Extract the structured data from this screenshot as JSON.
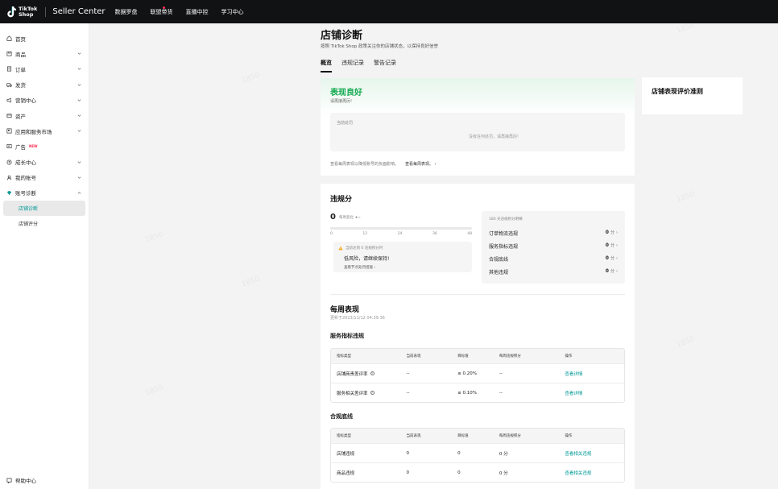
{
  "topbar": {
    "logo_line1": "TikTok",
    "logo_line2": "Shop",
    "product": "Seller Center",
    "nav": [
      "数据罗盘",
      "联盟带货",
      "直播中控",
      "学习中心"
    ]
  },
  "sidebar": {
    "items": [
      {
        "label": "首页",
        "icon": "home-icon"
      },
      {
        "label": "商品",
        "icon": "product-icon"
      },
      {
        "label": "订单",
        "icon": "order-icon"
      },
      {
        "label": "发货",
        "icon": "shipping-icon"
      },
      {
        "label": "营销中心",
        "icon": "megaphone-icon"
      },
      {
        "label": "资产",
        "icon": "wallet-icon"
      },
      {
        "label": "应用和服务市场",
        "icon": "apps-icon"
      },
      {
        "label": "广告",
        "icon": "ad-icon",
        "badge": "NEW"
      },
      {
        "label": "成长中心",
        "icon": "growth-icon"
      },
      {
        "label": "我的账号",
        "icon": "account-icon"
      },
      {
        "label": "账号诊断",
        "icon": "diagnosis-icon"
      }
    ],
    "sub_items": [
      "店铺诊断",
      "店铺评分"
    ],
    "help": "帮助中心"
  },
  "main": {
    "title": "店铺诊断",
    "subtitle": "按照 TikTok Shop 政策关注你的店铺状态，以保持良好信誉",
    "tabs": [
      "概览",
      "违规记录",
      "警告记录"
    ],
    "status": {
      "title": "表现良好",
      "subtitle": "请再接再厉!",
      "penalty_label": "当前处罚",
      "penalty_empty": "没有任何处罚，请再接再厉!",
      "footer_text": "查看每周表现以降低账号的负面影响。",
      "footer_link": "查看每周表现。"
    },
    "violation": {
      "title": "违规分",
      "score": "0",
      "score_label": "每周变化",
      "score_change": "+--",
      "ticks": [
        "0",
        "12",
        "24",
        "36",
        "48"
      ],
      "risk_line1": "当前达到 0 违规积分时",
      "risk_line2": "低风险，请继续保持!",
      "risk_line3": "查看节点处罚措施",
      "detail_head": "180 天违规积分明细",
      "details": [
        {
          "label": "订单物流违规",
          "value": "0",
          "unit": "分"
        },
        {
          "label": "服务指标违规",
          "value": "0",
          "unit": "分"
        },
        {
          "label": "合规底线",
          "value": "0",
          "unit": "分"
        },
        {
          "label": "其他违规",
          "value": "0",
          "unit": "分"
        }
      ]
    },
    "weekly": {
      "title": "每周表现",
      "updated": "更新于2023/11/12 04:39:36",
      "service_title": "服务指标违规",
      "service_headers": [
        "指标类型",
        "当前表现",
        "目标值",
        "每周违规积分",
        "操作"
      ],
      "service_rows": [
        {
          "type": "店铺商责差评率",
          "current": "--",
          "target": "≤ 0.20%",
          "points": "--",
          "action": "查看详情"
        },
        {
          "type": "服务相关差评率",
          "current": "--",
          "target": "≤ 0.10%",
          "points": "--",
          "action": "查看详情"
        }
      ],
      "compliance_title": "合规底线",
      "compliance_headers": [
        "指标类型",
        "当前表现",
        "目标值",
        "每周违规积分",
        "操作"
      ],
      "compliance_rows": [
        {
          "type": "店铺违规",
          "current": "0",
          "target": "0",
          "points": "0 分",
          "action": "查看相关违规"
        },
        {
          "type": "商品违规",
          "current": "0",
          "target": "0",
          "points": "0 分",
          "action": "查看相关违规"
        }
      ]
    },
    "rules_card_title": "店铺表现评价准则"
  },
  "watermark": "1850",
  "colors": {
    "accent": "#009995",
    "good": "#13a94f",
    "topbar": "#111214"
  }
}
